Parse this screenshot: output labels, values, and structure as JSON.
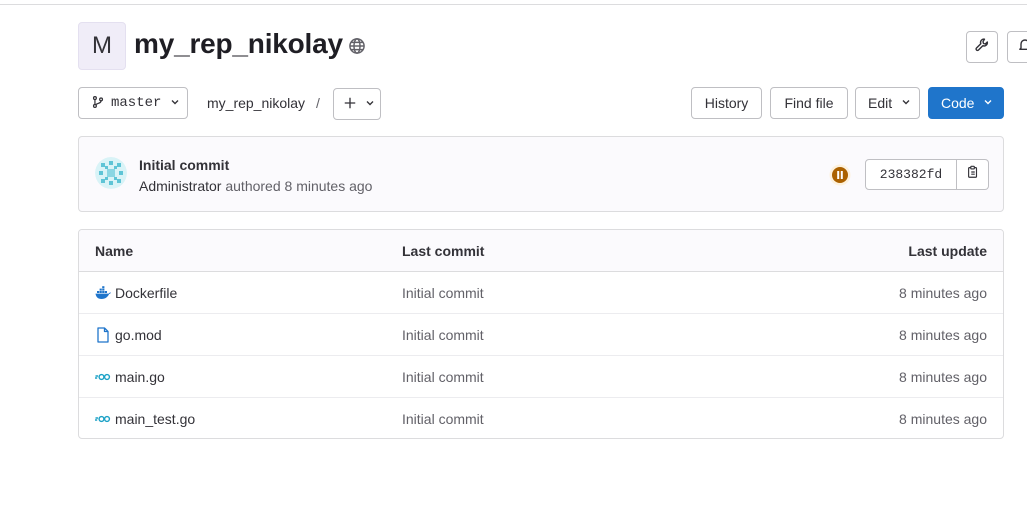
{
  "project": {
    "avatar_letter": "M",
    "name": "my_rep_nikolay",
    "visibility_icon": "globe-icon"
  },
  "toolbar": {
    "branch": "master",
    "breadcrumb": "my_rep_nikolay",
    "breadcrumb_sep": "/",
    "history_label": "History",
    "find_file_label": "Find file",
    "edit_label": "Edit",
    "code_label": "Code"
  },
  "commit": {
    "title": "Initial commit",
    "author": "Administrator",
    "meta": " authored 8 minutes ago",
    "sha": "238382fd",
    "pipeline_status": "paused"
  },
  "table": {
    "headers": {
      "name": "Name",
      "last_commit": "Last commit",
      "last_update": "Last update"
    },
    "rows": [
      {
        "name": "Dockerfile",
        "icon": "docker-icon",
        "commit": "Initial commit",
        "updated": "8 minutes ago"
      },
      {
        "name": "go.mod",
        "icon": "file-icon",
        "commit": "Initial commit",
        "updated": "8 minutes ago"
      },
      {
        "name": "main.go",
        "icon": "go-icon",
        "commit": "Initial commit",
        "updated": "8 minutes ago"
      },
      {
        "name": "main_test.go",
        "icon": "go-icon",
        "commit": "Initial commit",
        "updated": "8 minutes ago"
      }
    ]
  },
  "colors": {
    "primary": "#1f75cb",
    "pipeline": "#ab6100",
    "go": "#1ba1c6",
    "docker": "#1f75cb"
  }
}
